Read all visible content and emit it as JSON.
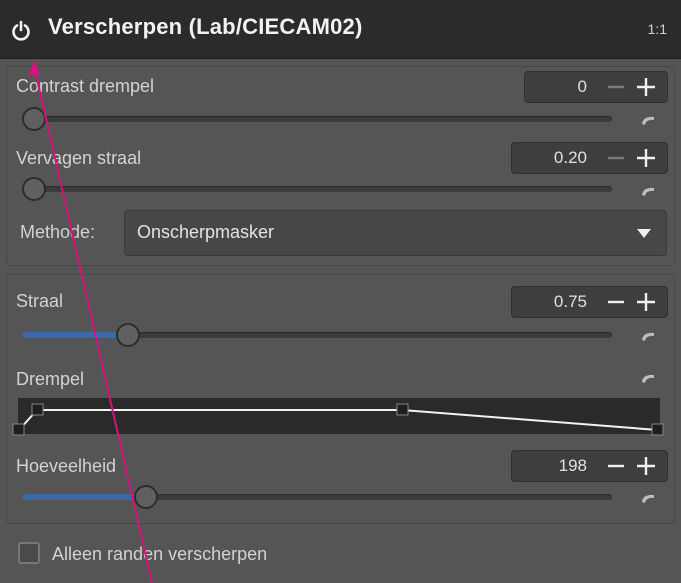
{
  "header": {
    "title": "Verscherpen (Lab/CIECAM02)",
    "scale": "1:1"
  },
  "contrast": {
    "label": "Contrast drempel",
    "value": "0"
  },
  "blur": {
    "label": "Vervagen straal",
    "value": "0.20"
  },
  "method": {
    "label": "Methode:",
    "selected": "Onscherpmasker"
  },
  "radius": {
    "label": "Straal",
    "value": "0.75"
  },
  "threshold": {
    "label": "Drempel"
  },
  "amount": {
    "label": "Hoeveelheid",
    "value": "198"
  },
  "edges_only": {
    "label": "Alleen randen verscherpen",
    "checked": false
  },
  "colors": {
    "accent_fill": "#3b6aa6",
    "annotation": "#d0167a"
  }
}
